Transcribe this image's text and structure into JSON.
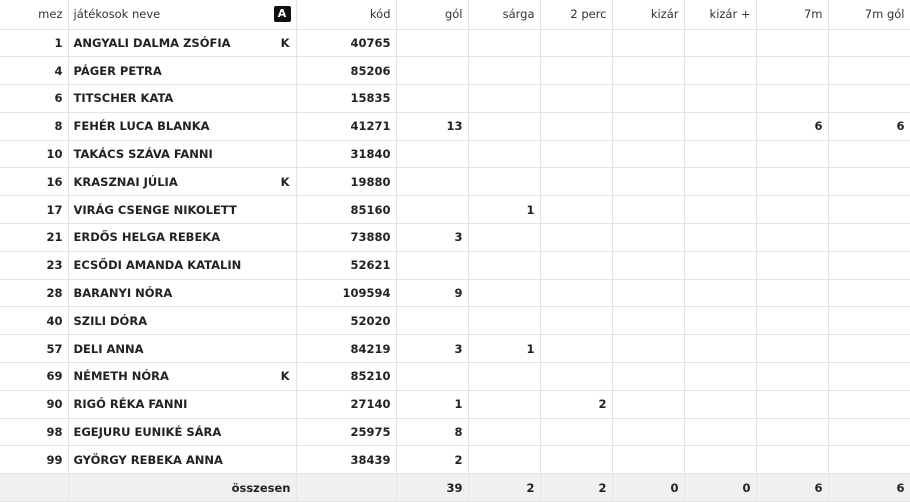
{
  "headers": {
    "mez": "mez",
    "name": "játékosok neve",
    "badge": "A",
    "kod": "kód",
    "gol": "gól",
    "sarga": "sárga",
    "ket_perc": "2 perc",
    "kizar": "kizár",
    "kizar_plus": "kizár +",
    "het_m": "7m",
    "het_m_gol": "7m gól"
  },
  "rows": [
    {
      "mez": "1",
      "name": "ANGYALI DALMA ZSÓFIA",
      "k": "K",
      "kod": "40765",
      "gol": "",
      "sarga": "",
      "ket_perc": "",
      "kizar": "",
      "kizar_plus": "",
      "het_m": "",
      "het_m_gol": ""
    },
    {
      "mez": "4",
      "name": "PÁGER PETRA",
      "k": "",
      "kod": "85206",
      "gol": "",
      "sarga": "",
      "ket_perc": "",
      "kizar": "",
      "kizar_plus": "",
      "het_m": "",
      "het_m_gol": ""
    },
    {
      "mez": "6",
      "name": "TITSCHER KATA",
      "k": "",
      "kod": "15835",
      "gol": "",
      "sarga": "",
      "ket_perc": "",
      "kizar": "",
      "kizar_plus": "",
      "het_m": "",
      "het_m_gol": ""
    },
    {
      "mez": "8",
      "name": "FEHÉR LUCA BLANKA",
      "k": "",
      "kod": "41271",
      "gol": "13",
      "sarga": "",
      "ket_perc": "",
      "kizar": "",
      "kizar_plus": "",
      "het_m": "6",
      "het_m_gol": "6"
    },
    {
      "mez": "10",
      "name": "TAKÁCS SZÁVA FANNI",
      "k": "",
      "kod": "31840",
      "gol": "",
      "sarga": "",
      "ket_perc": "",
      "kizar": "",
      "kizar_plus": "",
      "het_m": "",
      "het_m_gol": ""
    },
    {
      "mez": "16",
      "name": "KRASZNAI JÚLIA",
      "k": "K",
      "kod": "19880",
      "gol": "",
      "sarga": "",
      "ket_perc": "",
      "kizar": "",
      "kizar_plus": "",
      "het_m": "",
      "het_m_gol": ""
    },
    {
      "mez": "17",
      "name": "VIRÁG CSENGE NIKOLETT",
      "k": "",
      "kod": "85160",
      "gol": "",
      "sarga": "1",
      "ket_perc": "",
      "kizar": "",
      "kizar_plus": "",
      "het_m": "",
      "het_m_gol": ""
    },
    {
      "mez": "21",
      "name": "ERDŐS HELGA REBEKA",
      "k": "",
      "kod": "73880",
      "gol": "3",
      "sarga": "",
      "ket_perc": "",
      "kizar": "",
      "kizar_plus": "",
      "het_m": "",
      "het_m_gol": ""
    },
    {
      "mez": "23",
      "name": "ECSŐDI AMANDA KATALIN",
      "k": "",
      "kod": "52621",
      "gol": "",
      "sarga": "",
      "ket_perc": "",
      "kizar": "",
      "kizar_plus": "",
      "het_m": "",
      "het_m_gol": ""
    },
    {
      "mez": "28",
      "name": "BARANYI NÓRA",
      "k": "",
      "kod": "109594",
      "gol": "9",
      "sarga": "",
      "ket_perc": "",
      "kizar": "",
      "kizar_plus": "",
      "het_m": "",
      "het_m_gol": ""
    },
    {
      "mez": "40",
      "name": "SZILI DÓRA",
      "k": "",
      "kod": "52020",
      "gol": "",
      "sarga": "",
      "ket_perc": "",
      "kizar": "",
      "kizar_plus": "",
      "het_m": "",
      "het_m_gol": ""
    },
    {
      "mez": "57",
      "name": "DELI ANNA",
      "k": "",
      "kod": "84219",
      "gol": "3",
      "sarga": "1",
      "ket_perc": "",
      "kizar": "",
      "kizar_plus": "",
      "het_m": "",
      "het_m_gol": ""
    },
    {
      "mez": "69",
      "name": "NÉMETH NÓRA",
      "k": "K",
      "kod": "85210",
      "gol": "",
      "sarga": "",
      "ket_perc": "",
      "kizar": "",
      "kizar_plus": "",
      "het_m": "",
      "het_m_gol": ""
    },
    {
      "mez": "90",
      "name": "RIGÓ RÉKA FANNI",
      "k": "",
      "kod": "27140",
      "gol": "1",
      "sarga": "",
      "ket_perc": "2",
      "kizar": "",
      "kizar_plus": "",
      "het_m": "",
      "het_m_gol": ""
    },
    {
      "mez": "98",
      "name": "EGEJURU EUNIKÉ SÁRA",
      "k": "",
      "kod": "25975",
      "gol": "8",
      "sarga": "",
      "ket_perc": "",
      "kizar": "",
      "kizar_plus": "",
      "het_m": "",
      "het_m_gol": ""
    },
    {
      "mez": "99",
      "name": "GYÖRGY REBEKA ANNA",
      "k": "",
      "kod": "38439",
      "gol": "2",
      "sarga": "",
      "ket_perc": "",
      "kizar": "",
      "kizar_plus": "",
      "het_m": "",
      "het_m_gol": ""
    }
  ],
  "totals": {
    "label": "összesen",
    "gol": "39",
    "sarga": "2",
    "ket_perc": "2",
    "kizar": "0",
    "kizar_plus": "0",
    "het_m": "6",
    "het_m_gol": "6"
  }
}
